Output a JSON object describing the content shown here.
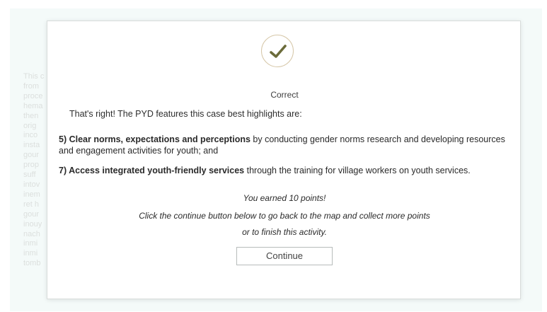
{
  "background": {
    "lines": [
      "This c",
      "from",
      "proce",
      "hema",
      "then",
      "orig",
      "inco",
      "insta",
      "gour",
      "prop",
      "suff",
      "intov",
      "inem",
      "ret h",
      "gour",
      "inouy",
      "nach",
      "inmi",
      "inmi",
      "tomb"
    ]
  },
  "feedback": {
    "icon": "checkmark-icon",
    "title": "Correct",
    "intro": "That's right! The PYD features this case best highlights are:",
    "item5": {
      "bold": "5) Clear norms, expectations and perceptions",
      "rest": " by conducting gender norms research and developing resources and engagement activities for youth; and"
    },
    "item7": {
      "bold": "7) Access integrated youth-friendly services",
      "rest": " through the training for village workers on youth services."
    },
    "points": "You earned 10 points!",
    "instruction_line1": "Click the continue button below to go back to the map and collect more points",
    "instruction_line2": "or to finish this activity.",
    "continue_label": "Continue"
  },
  "colors": {
    "check": "#6b6b3a",
    "badge_border": "#d6c7a8",
    "bg_panel": "#eef7f6"
  }
}
